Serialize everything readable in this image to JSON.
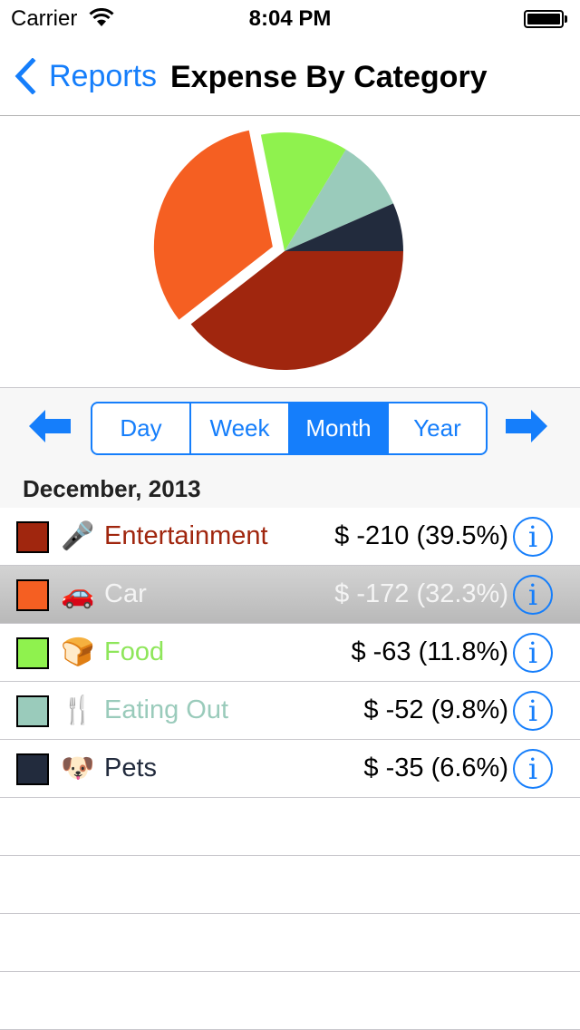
{
  "status_bar": {
    "carrier": "Carrier",
    "time": "8:04 PM",
    "wifi_icon": "wifi-icon",
    "battery_icon": "battery-full-icon"
  },
  "nav": {
    "back_label": "Reports",
    "back_icon": "chevron-left-icon",
    "title": "Expense By Category"
  },
  "period_selector": {
    "prev_icon": "arrow-left-icon",
    "next_icon": "arrow-right-icon",
    "segments": [
      {
        "label": "Day",
        "selected": false
      },
      {
        "label": "Week",
        "selected": false
      },
      {
        "label": "Month",
        "selected": true
      },
      {
        "label": "Year",
        "selected": false
      }
    ],
    "accent_color": "#157efb"
  },
  "section_header": "December, 2013",
  "categories": [
    {
      "name": "Entertainment",
      "emoji": "🎤",
      "icon": "microphone-icon",
      "amount": "$ -210 (39.5%)",
      "color": "#a0260e",
      "label_color": "#a0260e",
      "selected": false
    },
    {
      "name": "Car",
      "emoji": "🚗",
      "icon": "car-icon",
      "amount": "$ -172 (32.3%)",
      "color": "#f55f22",
      "label_color": "#f4f4f4",
      "selected": true
    },
    {
      "name": "Food",
      "emoji": "🍞",
      "icon": "bread-icon",
      "amount": "$ -63 (11.8%)",
      "color": "#8ff24e",
      "label_color": "#8ee65a",
      "selected": false
    },
    {
      "name": "Eating Out",
      "emoji": "🍴",
      "icon": "fork-knife-icon",
      "amount": "$ -52 (9.8%)",
      "color": "#9acbbb",
      "label_color": "#9acbbb",
      "selected": false
    },
    {
      "name": "Pets",
      "emoji": "🐶",
      "icon": "dog-icon",
      "amount": "$ -35 (6.6%)",
      "color": "#222b3d",
      "label_color": "#222b3d",
      "selected": false
    }
  ],
  "info_glyph": "i",
  "empty_rows": 4,
  "chart_data": {
    "type": "pie",
    "title": "",
    "categories": [
      "Entertainment",
      "Car",
      "Food",
      "Eating Out",
      "Pets"
    ],
    "values": [
      210,
      172,
      63,
      52,
      35
    ],
    "percentages": [
      39.5,
      32.3,
      11.8,
      9.8,
      6.6
    ],
    "colors": [
      "#a0260e",
      "#f55f22",
      "#8ff24e",
      "#9acbbb",
      "#222b3d"
    ],
    "exploded": [
      "Car"
    ],
    "start_angle": "3 o'clock",
    "direction": "clockwise",
    "legend": "list-below"
  }
}
